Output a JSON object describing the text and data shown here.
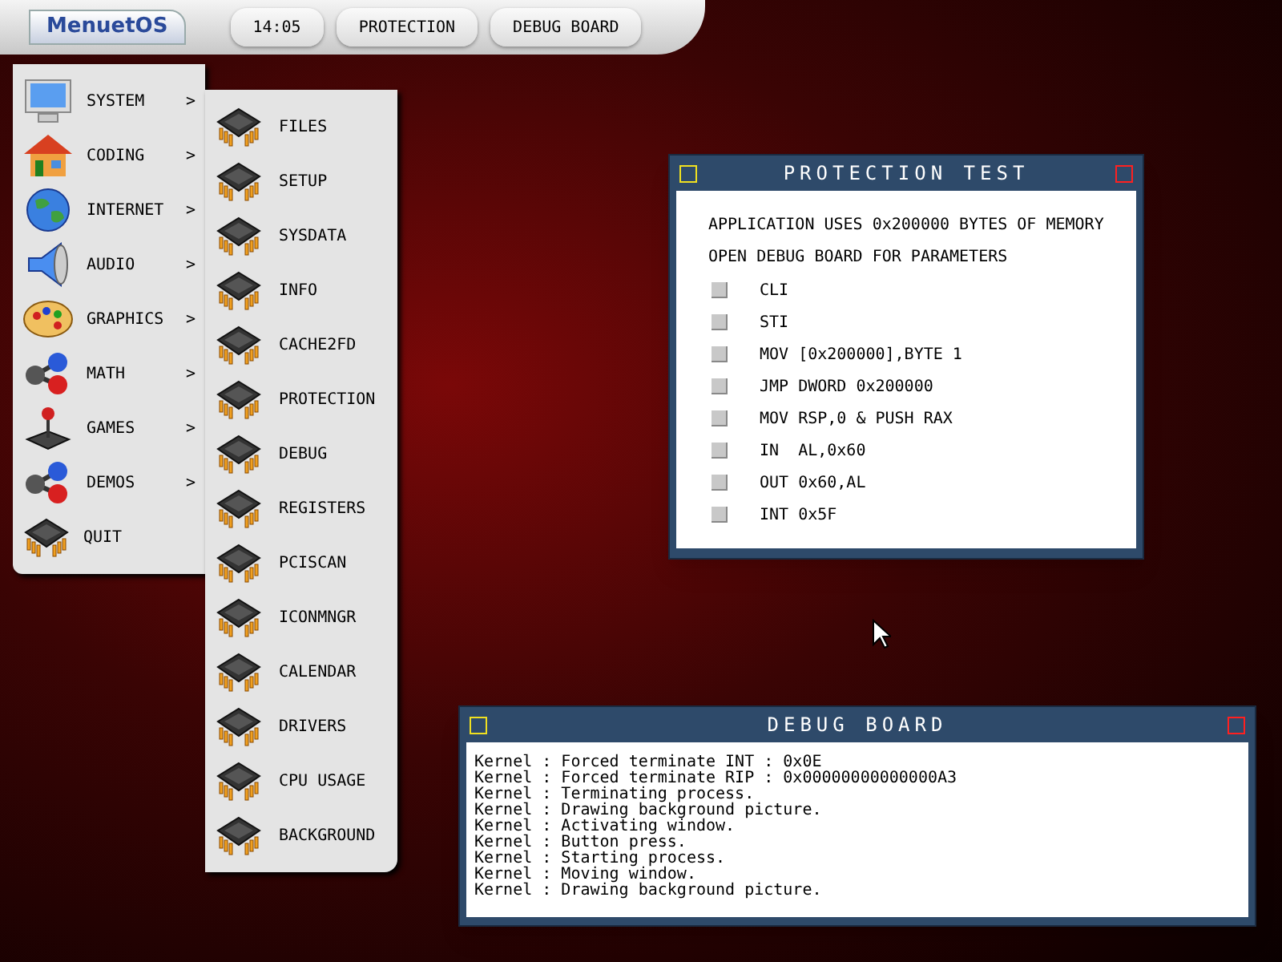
{
  "taskbar": {
    "logo": "MenuetOS",
    "buttons": [
      "14:05",
      "PROTECTION",
      "DEBUG BOARD"
    ]
  },
  "main_menu": [
    {
      "label": "SYSTEM",
      "kind": "submenu"
    },
    {
      "label": "CODING",
      "kind": "submenu"
    },
    {
      "label": "INTERNET",
      "kind": "submenu"
    },
    {
      "label": "AUDIO",
      "kind": "submenu"
    },
    {
      "label": "GRAPHICS",
      "kind": "submenu"
    },
    {
      "label": "MATH",
      "kind": "submenu"
    },
    {
      "label": "GAMES",
      "kind": "submenu"
    },
    {
      "label": "DEMOS",
      "kind": "submenu"
    },
    {
      "label": "QUIT",
      "kind": "action"
    }
  ],
  "arrow": ">",
  "submenu": [
    "FILES",
    "SETUP",
    "SYSDATA",
    "INFO",
    "CACHE2FD",
    "PROTECTION",
    "DEBUG",
    "REGISTERS",
    "PCISCAN",
    "ICONMNGR",
    "CALENDAR",
    "DRIVERS",
    "CPU USAGE",
    "BACKGROUND"
  ],
  "protection_window": {
    "title": "PROTECTION TEST",
    "lines": [
      "APPLICATION USES 0x200000 BYTES OF MEMORY",
      "OPEN DEBUG BOARD FOR PARAMETERS"
    ],
    "options": [
      "CLI",
      "STI",
      "MOV [0x200000],BYTE 1",
      "JMP DWORD 0x200000",
      "MOV RSP,0 & PUSH RAX",
      "IN  AL,0x60",
      "OUT 0x60,AL",
      "INT 0x5F"
    ]
  },
  "debug_window": {
    "title": "DEBUG BOARD",
    "log": [
      "Kernel : Forced terminate INT : 0x0E",
      "Kernel : Forced terminate RIP : 0x00000000000000A3",
      "Kernel : Terminating process.",
      "Kernel : Drawing background picture.",
      "Kernel : Activating window.",
      "Kernel : Button press.",
      "Kernel : Starting process.",
      "Kernel : Moving window.",
      "Kernel : Drawing background picture."
    ]
  }
}
